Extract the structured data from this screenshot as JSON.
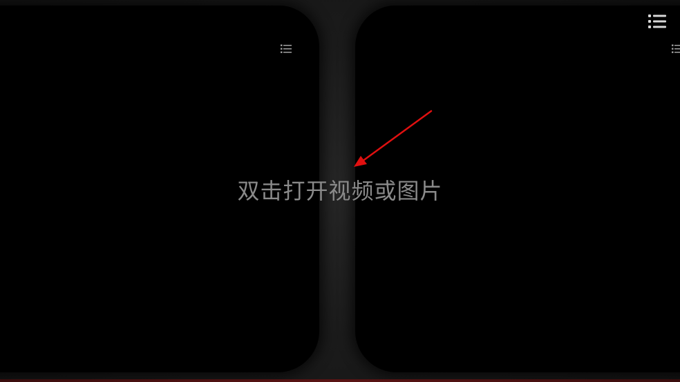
{
  "prompt": {
    "text": "双击打开视频或图片"
  },
  "icons": {
    "menu_main": "list-icon",
    "menu_left_eye": "list-icon",
    "menu_right_eye": "list-icon"
  },
  "colors": {
    "lens": "#000000",
    "frame": "#1b1b1b",
    "prompt_text": "#8a8a8a",
    "icon": "#d8d8d8",
    "annotation_arrow": "#e01010"
  }
}
